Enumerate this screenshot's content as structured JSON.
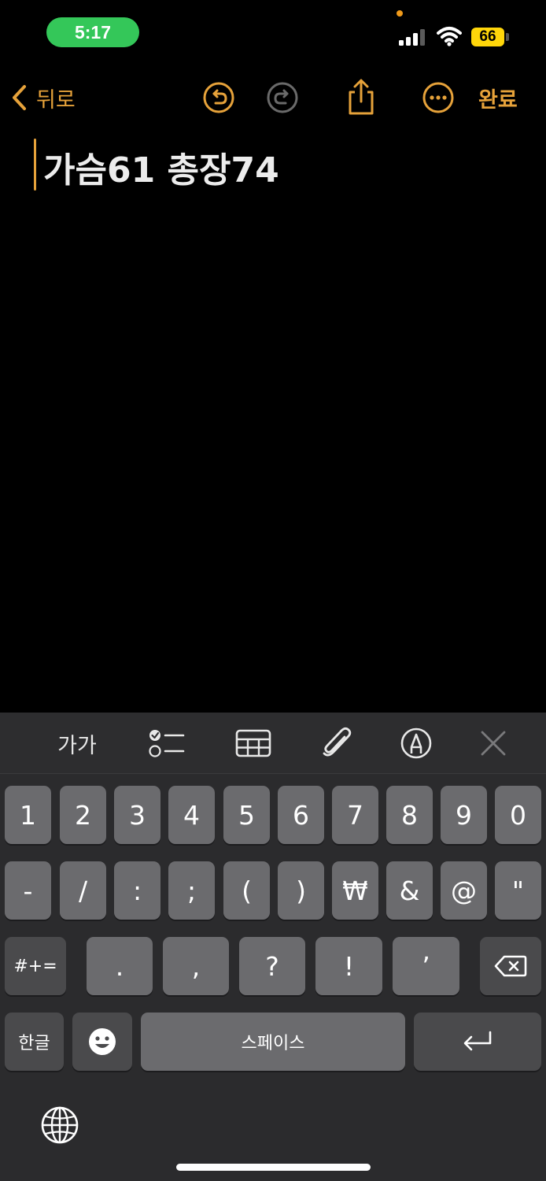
{
  "status": {
    "time": "5:17",
    "battery": "66"
  },
  "nav": {
    "back_label": "뒤로",
    "done_label": "완료"
  },
  "note": {
    "title": "가슴61 총장74"
  },
  "toolbar": {
    "format_label": "가가"
  },
  "keyboard": {
    "row1": [
      "1",
      "2",
      "3",
      "4",
      "5",
      "6",
      "7",
      "8",
      "9",
      "0"
    ],
    "row2": [
      "-",
      "/",
      ":",
      ";",
      "(",
      ")",
      "₩",
      "&",
      "@",
      "\""
    ],
    "row3": [
      ".",
      ",",
      "?",
      "!",
      "’"
    ],
    "symbols_label": "#+=",
    "hangul_label": "한글",
    "space_label": "스페이스"
  },
  "colors": {
    "accent": "#e6a23a",
    "time_pill": "#34c759",
    "battery": "#ffd60a"
  },
  "icons": {
    "nav": [
      "chevron-left-icon",
      "undo-icon",
      "redo-icon",
      "share-icon",
      "more-icon"
    ],
    "toolbar": [
      "checklist-icon",
      "table-icon",
      "paperclip-icon",
      "markup-pen-icon",
      "close-icon"
    ],
    "keyboard": [
      "backspace-icon",
      "emoji-icon",
      "return-icon",
      "globe-icon"
    ]
  }
}
